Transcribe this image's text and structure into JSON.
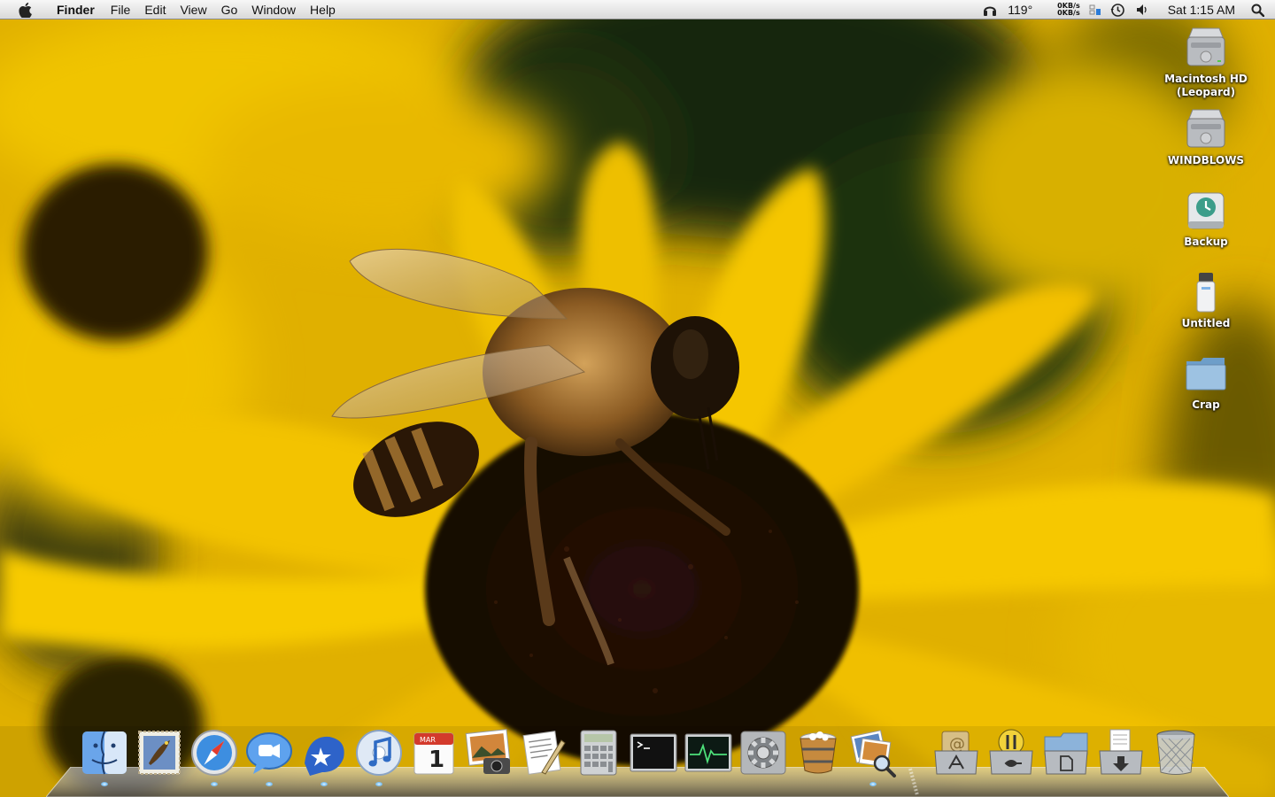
{
  "menubar": {
    "app_name": "Finder",
    "menus": [
      "File",
      "Edit",
      "View",
      "Go",
      "Window",
      "Help"
    ],
    "temperature": "119°",
    "net_up": "0KB/s",
    "net_down": "0KB/s",
    "clock": "Sat 1:15 AM",
    "icons": [
      "apple-icon",
      "headphones-icon",
      "network-monitor-icon",
      "time-machine-icon",
      "volume-icon",
      "spotlight-icon"
    ]
  },
  "desktop": {
    "icons": [
      {
        "label": "Macintosh HD (Leopard)",
        "icon": "hard-drive-icon"
      },
      {
        "label": "WINDBLOWS",
        "icon": "hard-drive-icon"
      },
      {
        "label": "Backup",
        "icon": "time-machine-drive-icon"
      },
      {
        "label": "Untitled",
        "icon": "usb-drive-icon"
      },
      {
        "label": "Crap",
        "icon": "folder-icon"
      }
    ]
  },
  "dock": {
    "items": [
      {
        "name": "Finder",
        "icon": "finder-icon",
        "running": true
      },
      {
        "name": "Mail",
        "icon": "mail-icon",
        "running": false
      },
      {
        "name": "Safari",
        "icon": "safari-icon",
        "running": true
      },
      {
        "name": "iChat",
        "icon": "ichat-icon",
        "running": true
      },
      {
        "name": "Adium",
        "icon": "adium-icon",
        "running": true
      },
      {
        "name": "iTunes",
        "icon": "itunes-icon",
        "running": true
      },
      {
        "name": "iCal",
        "icon": "ical-icon",
        "running": false
      },
      {
        "name": "iPhoto",
        "icon": "iphoto-icon",
        "running": false
      },
      {
        "name": "TextEdit",
        "icon": "textedit-icon",
        "running": false
      },
      {
        "name": "Calculator",
        "icon": "calculator-icon",
        "running": false
      },
      {
        "name": "Terminal",
        "icon": "terminal-icon",
        "running": false
      },
      {
        "name": "Activity Monitor",
        "icon": "activity-monitor-icon",
        "running": false
      },
      {
        "name": "System Preferences",
        "icon": "system-preferences-icon",
        "running": false
      },
      {
        "name": "Transmission",
        "icon": "bucket-icon",
        "running": false
      },
      {
        "name": "Preview",
        "icon": "preview-icon",
        "running": true
      },
      {
        "name": "Applications",
        "icon": "applications-stack-icon",
        "running": false
      },
      {
        "name": "Utilities",
        "icon": "utilities-stack-icon",
        "running": false
      },
      {
        "name": "Documents",
        "icon": "documents-stack-icon",
        "running": false
      },
      {
        "name": "Downloads",
        "icon": "downloads-stack-icon",
        "running": false
      },
      {
        "name": "Trash",
        "icon": "trash-icon",
        "running": false
      }
    ]
  },
  "calendar_icon": {
    "month": "MAR",
    "day": "1"
  }
}
